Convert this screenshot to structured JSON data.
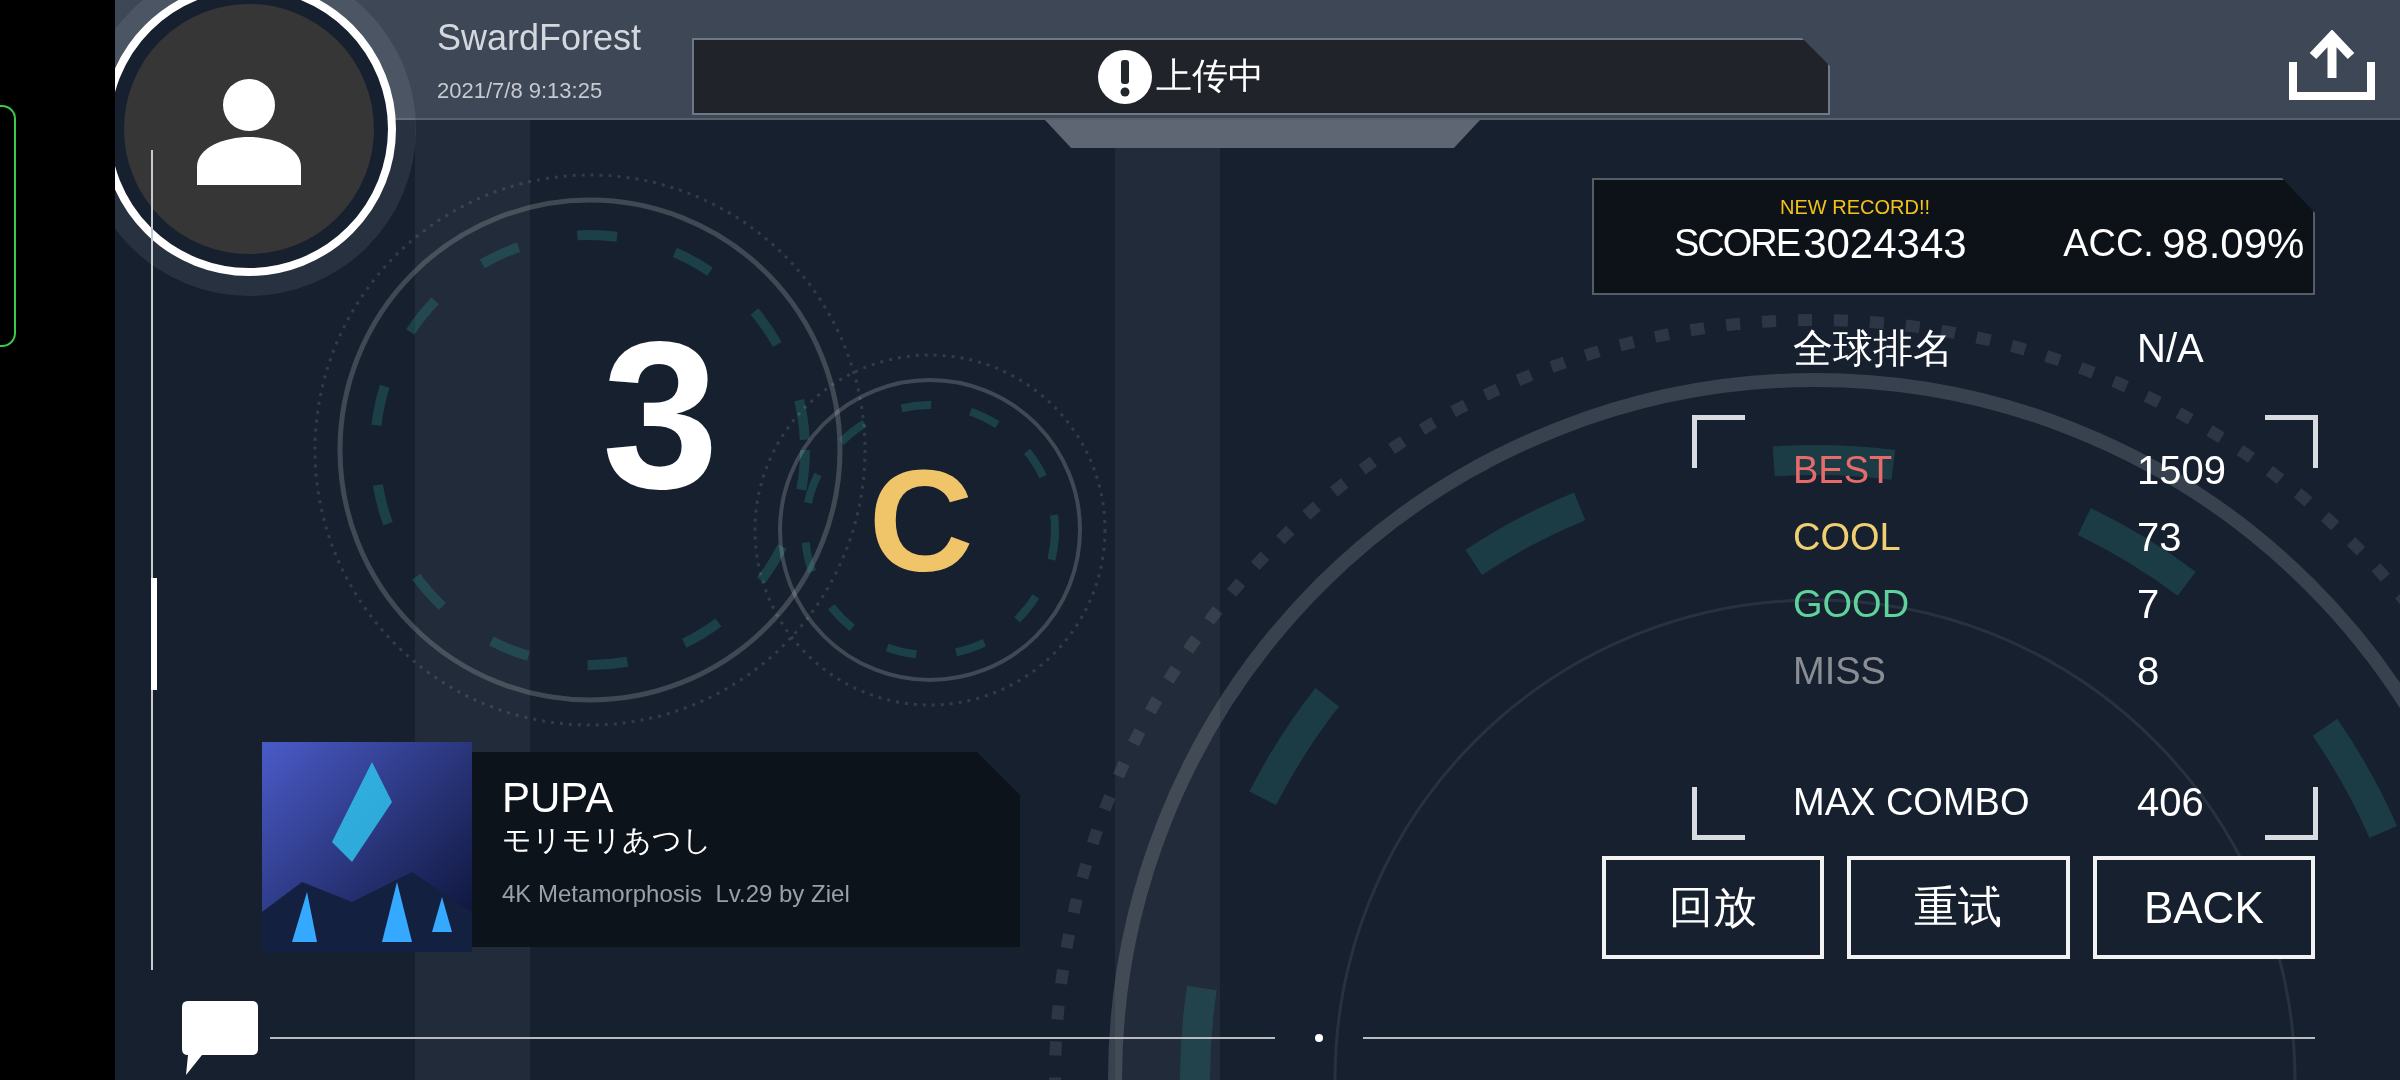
{
  "user": {
    "name": "SwardForest",
    "date": "2021/7/8 9:13:25"
  },
  "toast": {
    "text": "上传中"
  },
  "grade": {
    "primary": "3",
    "secondary": "C"
  },
  "song": {
    "title": "PUPA",
    "artist": "モリモリあつし",
    "info": "4K Metamorphosis  Lv.29 by Ziel"
  },
  "score": {
    "badge": "NEW RECORD!!",
    "label": "SCORE",
    "value": "3024343",
    "acc_label": "ACC.",
    "acc": "98.09%"
  },
  "ranking": {
    "label": "全球排名",
    "value": "N/A"
  },
  "judgements": [
    {
      "label": "BEST",
      "value": "1509",
      "color": "#e86b6b"
    },
    {
      "label": "COOL",
      "value": "73",
      "color": "#f0cf73"
    },
    {
      "label": "GOOD",
      "value": "7",
      "color": "#5fd39b"
    },
    {
      "label": "MISS",
      "value": "8",
      "color": "#8a8d93"
    }
  ],
  "max_combo": {
    "label": "MAX COMBO",
    "value": "406"
  },
  "buttons": [
    "回放",
    "重试",
    "BACK"
  ]
}
